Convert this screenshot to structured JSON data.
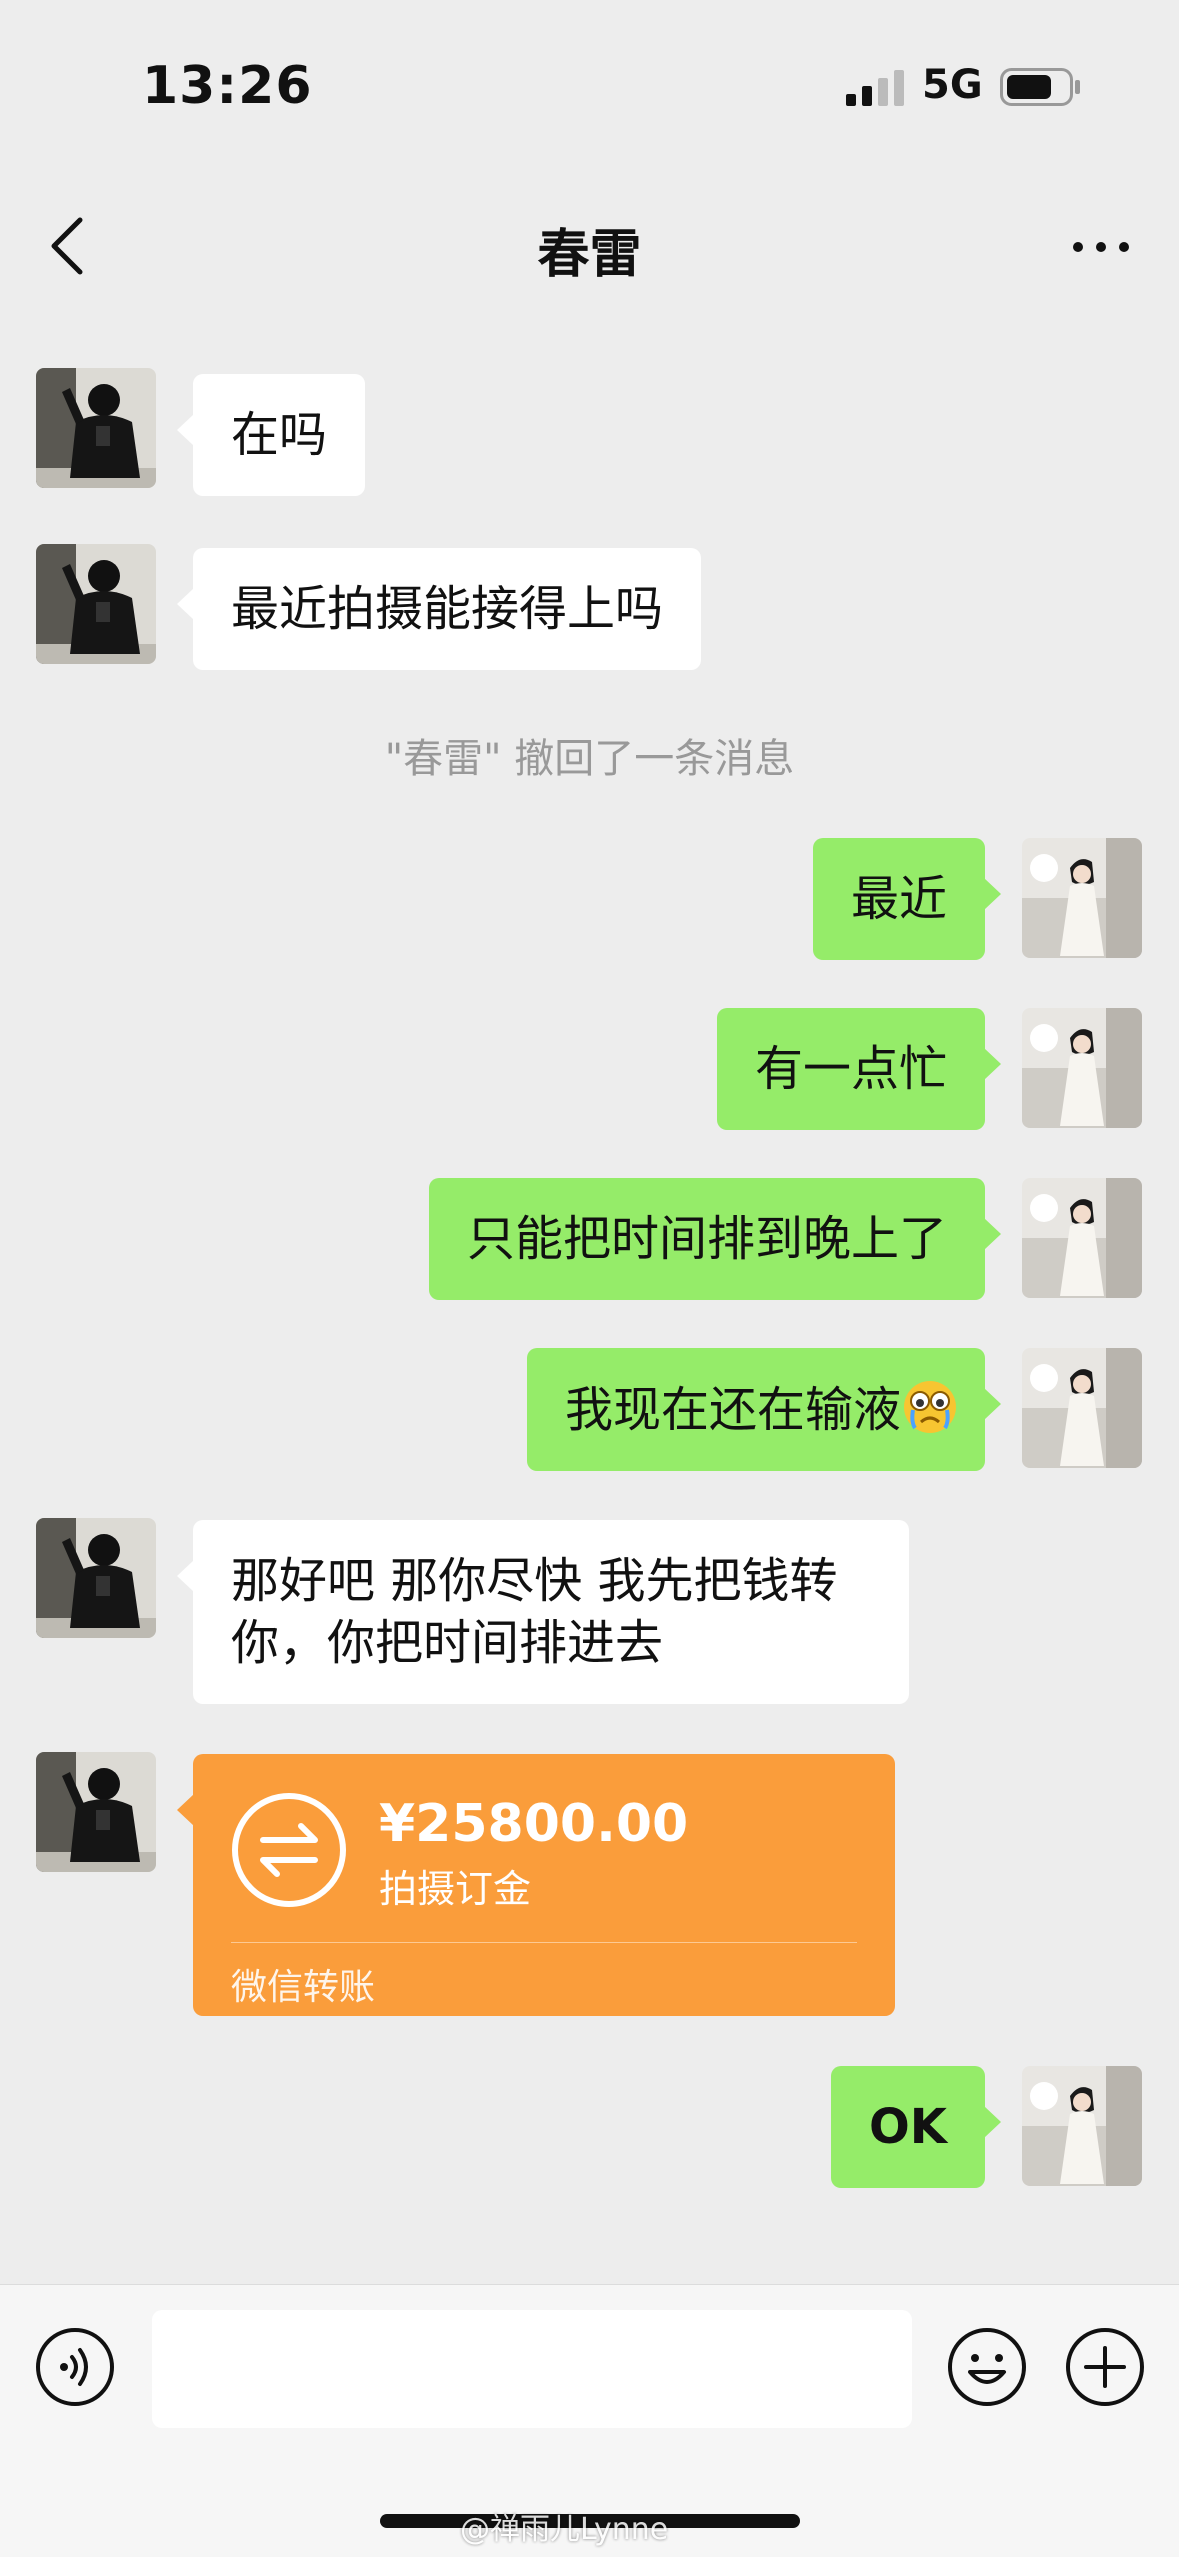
{
  "status_bar": {
    "time": "13:26",
    "network": "5G"
  },
  "header": {
    "title": "春雷"
  },
  "messages": [
    {
      "from": "contact",
      "text": "在吗"
    },
    {
      "from": "contact",
      "text": "最近拍摄能接得上吗"
    },
    {
      "type": "system",
      "text": "\"春雷\" 撤回了一条消息"
    },
    {
      "from": "me",
      "text": "最近"
    },
    {
      "from": "me",
      "text": "有一点忙"
    },
    {
      "from": "me",
      "text": "只能把时间排到晚上了"
    },
    {
      "from": "me",
      "text": "我现在还在输液"
    },
    {
      "from": "contact",
      "text": "那好吧 那你尽快 我先把钱转你，你把时间排进去"
    },
    {
      "from": "contact",
      "type": "transfer",
      "amount": "¥25800.00",
      "note": "拍摄订金",
      "source": "微信转账"
    },
    {
      "from": "me",
      "text": "OK"
    }
  ],
  "colors": {
    "outgoing_bubble": "#95ec69",
    "incoming_bubble": "#ffffff",
    "transfer_card": "#fa9d3b",
    "background": "#ededed"
  },
  "input_bar": {
    "value": ""
  },
  "watermark": "@禅雨儿Lynne"
}
